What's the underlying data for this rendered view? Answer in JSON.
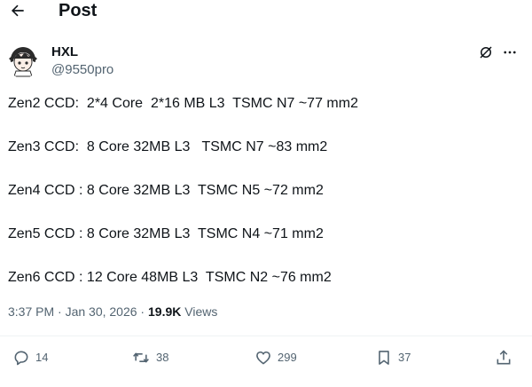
{
  "header": {
    "title": "Post",
    "back_icon": "arrow-left-icon"
  },
  "author": {
    "name": "HXL",
    "handle": "@9550pro",
    "avatar_icon": "anime-avatar"
  },
  "tweet": {
    "lines": [
      "Zen2 CCD:  2*4 Core  2*16 MB L3  TSMC N7 ~77 mm2",
      "Zen3 CCD:  8 Core 32MB L3   TSMC N7 ~83 mm2",
      "Zen4 CCD : 8 Core 32MB L3  TSMC N5 ~72 mm2",
      "Zen5 CCD : 8 Core 32MB L3  TSMC N4 ~71 mm2",
      "Zen6 CCD : 12 Core 48MB L3  TSMC N2 ~76 mm2"
    ]
  },
  "meta": {
    "timestamp": "3:37 PM · Jan 30, 2026",
    "separator": " · ",
    "views_count": "19.9K",
    "views_label": " Views"
  },
  "actions": {
    "replies": "14",
    "reposts": "38",
    "likes": "299",
    "bookmarks": "37"
  },
  "colors": {
    "text": "#0f1419",
    "secondary": "#536471",
    "divider": "#eff3f4"
  }
}
